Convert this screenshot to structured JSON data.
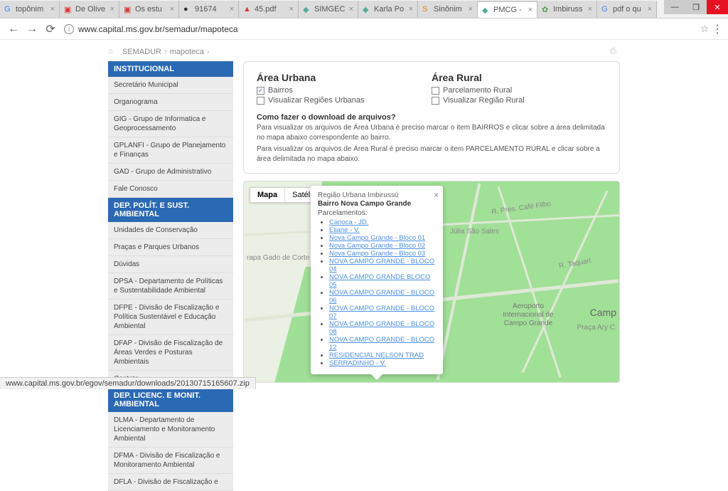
{
  "window": {
    "min": "—",
    "max": "❐",
    "close": "✕"
  },
  "tabs": [
    {
      "fav": "G",
      "label": "topônim",
      "color": "#4285f4"
    },
    {
      "fav": "▣",
      "label": "De Olive",
      "color": "#d33"
    },
    {
      "fav": "▣",
      "label": "Os estu",
      "color": "#d33"
    },
    {
      "fav": "●",
      "label": "91674",
      "color": "#333"
    },
    {
      "fav": "▲",
      "label": "45.pdf",
      "color": "#d33"
    },
    {
      "fav": "◆",
      "label": "SIMGEC",
      "color": "#5a9"
    },
    {
      "fav": "◆",
      "label": "Karla Po",
      "color": "#5a9"
    },
    {
      "fav": "S",
      "label": "Sinônim",
      "color": "#e67e22"
    },
    {
      "fav": "◆",
      "label": "PMCG -",
      "color": "#5a9",
      "active": true
    },
    {
      "fav": "✿",
      "label": "Imbiruss",
      "color": "#4a4"
    },
    {
      "fav": "G",
      "label": "pdf o qu",
      "color": "#4285f4"
    }
  ],
  "addr": {
    "url": "www.capital.ms.gov.br/semadur/mapoteca"
  },
  "breadcrumb": {
    "a": "SEMADUR",
    "b": "mapoteca"
  },
  "side": {
    "h1": "INSTITUCIONAL",
    "g1": [
      "Secretário Municipal",
      "Organograma",
      "GIG - Grupo de Informatica e Geoprocessamento",
      "GPLANFI - Grupo de Planejamento e Finanças",
      "GAD - Grupo de Administrativo",
      "Fale Conosco"
    ],
    "h2": "DEP. POLÍT. E SUST. AMBIENTAL",
    "g2": [
      "Unidades de Conservação",
      "Praças e Parques Urbanos",
      "Dúvidas",
      "DPSA - Departamento de Políticas e Sustentabilidade Ambiental",
      "DFPE - Divisão de Fiscalização e Política Sustentável e Educação Ambiental",
      "DFAP - Divisão de Fiscalização de Áreas Verdes e Posturas Ambientais",
      "Contato"
    ],
    "h3": "DEP. LICENC. E MONIT. AMBIENTAL",
    "g3": [
      "DLMA - Departamento de Licenciamento e Monitoramento Ambiental",
      "DFMA - Divisão de Fiscalização e Monitoramento Ambiental",
      "DFLA - Divisão de Fiscalização e"
    ]
  },
  "panel": {
    "urb": {
      "title": "Área Urbana",
      "c1": "Bairros",
      "c2": "Visualizar Regiões Urbanas"
    },
    "rur": {
      "title": "Área Rural",
      "c1": "Parcelamento Rural",
      "c2": "Visualizar Região Rural"
    },
    "q": "Como fazer o download de arquivos?",
    "t1": "Para visualizar os arquivos de Área Urbana é preciso marcar o item BAIRROS e clicar sobre a área delimitada no mapa abaixo correspondente ao bairro.",
    "t2": "Para visualizar os arquivos de Área Rural é preciso marcar o item PARCELAMENTO RURAL e clicar sobre a área delimitada no mapa abaixo."
  },
  "map": {
    "btnMap": "Mapa",
    "btnSat": "Satélite",
    "region": "Região Urbana Imbirussú",
    "bairro": "Bairro Nova Campo Grande",
    "parc": "Parcelamentos:",
    "links": [
      "Carioca - JD.",
      "Eliane - V.",
      "Nova Campo Grande - Bloco 01",
      "Nova Campo Grande - Bloco 02",
      "Nova Campo Grande - Bloco 03",
      "NOVA CAMPO GRANDE - BLOCO 04",
      "NOVA CAMPO GRANDE BLOCO 05",
      "NOVA CAMPO GRANDE - BLOCO 06",
      "NOVA CAMPO GRANDE - BLOCO 07",
      "NOVA CAMPO GRANDE - BLOCO 08",
      "NOVA CAMPO GRANDE - BLOCO 12",
      "RESIDENCIAL NELSON TRAD",
      "SERRADINHO - V."
    ],
    "gado": "rapa Gado de Corte",
    "airport": "Aeroporto Internacional de Campo Grande",
    "campo": "Camp",
    "julia": "Júlia São Sales",
    "pres": "R. Pres. Café Filho",
    "taquari": "R. Taquari",
    "ary": "Praça Ary C"
  },
  "status": "www.capital.ms.gov.br/egov/semadur/downloads/20130715165607.zip"
}
